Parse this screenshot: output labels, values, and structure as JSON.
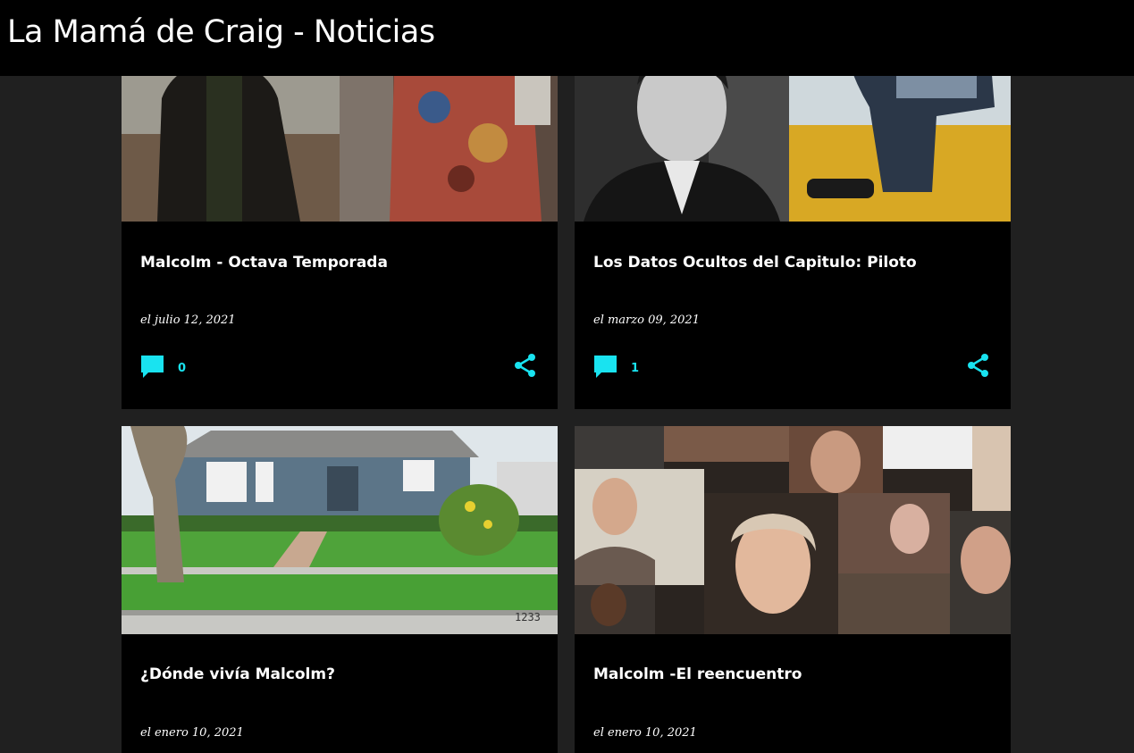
{
  "header": {
    "title": "La Mamá de Craig - Noticias"
  },
  "colors": {
    "accent": "#19e3f0",
    "background": "#202020",
    "card": "#000000"
  },
  "posts": [
    {
      "title": "Malcolm - Octava Temporada",
      "date": "el julio 12, 2021",
      "comments": "0",
      "thumbnail": "two-men-collage"
    },
    {
      "title": "Los Datos Ocultos del Capitulo: Piloto",
      "date": "el marzo 09, 2021",
      "comments": "1",
      "thumbnail": "man-portrait-and-boy"
    },
    {
      "title": "¿Dónde vivía Malcolm?",
      "date": "el enero 10, 2021",
      "comments": "",
      "thumbnail": "blue-house-front-yard"
    },
    {
      "title": "Malcolm -El reencuentro",
      "date": "el enero 10, 2021",
      "comments": "",
      "thumbnail": "video-call-collage"
    }
  ],
  "icons": {
    "comment": "comment-icon",
    "share": "share-icon"
  }
}
